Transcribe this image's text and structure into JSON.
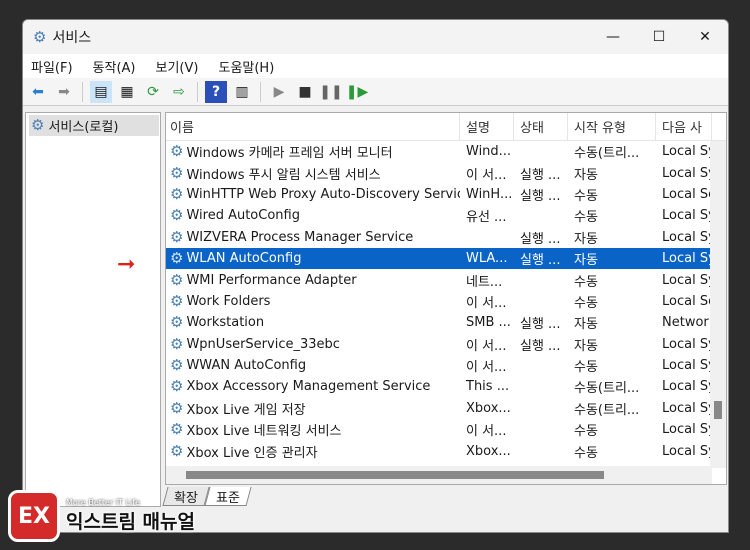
{
  "window": {
    "title": "서비스",
    "minimize": "—",
    "maximize": "☐",
    "close": "✕"
  },
  "menu": [
    "파일(F)",
    "동작(A)",
    "보기(V)",
    "도움말(H)"
  ],
  "tree": {
    "root": "서비스(로컬)"
  },
  "columns": [
    "이름",
    "설명",
    "상태",
    "시작 유형",
    "다음 사"
  ],
  "rows": [
    [
      "Windows 카메라 프레임 서버 모니터",
      "Wind...",
      "",
      "수동(트리...",
      "Local Sy"
    ],
    [
      "Windows 푸시 알림 시스템 서비스",
      "이 서...",
      "실행 ...",
      "자동",
      "Local Sy"
    ],
    [
      "WinHTTP Web Proxy Auto-Discovery Service",
      "WinH...",
      "실행 ...",
      "수동",
      "Local Se"
    ],
    [
      "Wired AutoConfig",
      "유선 ...",
      "",
      "수동",
      "Local Sy"
    ],
    [
      "WIZVERA Process Manager Service",
      "",
      "실행 ...",
      "자동",
      "Local Sy"
    ],
    [
      "WLAN AutoConfig",
      "WLA...",
      "실행 ...",
      "자동",
      "Local Sy"
    ],
    [
      "WMI Performance Adapter",
      "네트...",
      "",
      "수동",
      "Local Sy"
    ],
    [
      "Work Folders",
      "이 서...",
      "",
      "수동",
      "Local Se"
    ],
    [
      "Workstation",
      "SMB ...",
      "실행 ...",
      "자동",
      "Networ"
    ],
    [
      "WpnUserService_33ebc",
      "이 서...",
      "실행 ...",
      "자동",
      "Local Sy"
    ],
    [
      "WWAN AutoConfig",
      "이 서...",
      "",
      "수동",
      "Local Sy"
    ],
    [
      "Xbox Accessory Management Service",
      "This ...",
      "",
      "수동(트리...",
      "Local Sy"
    ],
    [
      "Xbox Live 게임 저장",
      "Xbox...",
      "",
      "수동(트리...",
      "Local Sy"
    ],
    [
      "Xbox Live 네트워킹 서비스",
      "이 서...",
      "",
      "수동",
      "Local Sy"
    ],
    [
      "Xbox Live 인증 관리자",
      "Xbox...",
      "",
      "수동",
      "Local Sy"
    ]
  ],
  "selected_row": 5,
  "tabs": [
    "확장",
    "표준"
  ],
  "active_tab": 1,
  "watermark": {
    "tagline": "More Better IT Life",
    "name": "익스트림 매뉴얼",
    "mark": "EX"
  },
  "colors": {
    "selection": "#0a64c8",
    "arrow": "#e0201b"
  }
}
